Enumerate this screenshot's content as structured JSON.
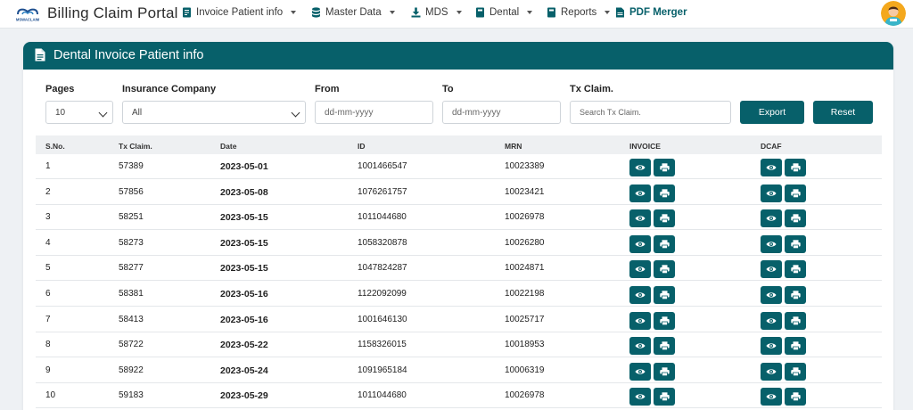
{
  "navbar": {
    "title": "Billing Claim Portal",
    "logo_text": "MSWACLAIM",
    "items": [
      {
        "label": "Invoice Patient info",
        "icon": "invoice-icon",
        "has_caret": true
      },
      {
        "label": "Master Data",
        "icon": "database-icon",
        "has_caret": true
      },
      {
        "label": "MDS",
        "icon": "download-icon",
        "has_caret": true
      },
      {
        "label": "Dental",
        "icon": "book-icon",
        "has_caret": true
      },
      {
        "label": "Reports",
        "icon": "book-icon",
        "has_caret": true
      },
      {
        "label": "PDF Merger",
        "icon": "pdf-file-icon",
        "has_caret": false
      }
    ]
  },
  "card": {
    "title": "Dental Invoice Patient info"
  },
  "filters": {
    "pages_label": "Pages",
    "pages_value": "10",
    "insurance_label": "Insurance Company",
    "insurance_value": "All",
    "from_label": "From",
    "from_placeholder": "dd-mm-yyyy",
    "to_label": "To",
    "to_placeholder": "dd-mm-yyyy",
    "txclaim_label": "Tx Claim.",
    "txclaim_placeholder": "Search Tx Claim.",
    "export_label": "Export",
    "reset_label": "Reset"
  },
  "table": {
    "headers": [
      "S.No.",
      "Tx Claim.",
      "Date",
      "ID",
      "MRN",
      "INVOICE",
      "DCAF"
    ],
    "rows": [
      [
        "1",
        "57389",
        "2023-05-01",
        "1001466547",
        "10023389"
      ],
      [
        "2",
        "57856",
        "2023-05-08",
        "1076261757",
        "10023421"
      ],
      [
        "3",
        "58251",
        "2023-05-15",
        "1011044680",
        "10026978"
      ],
      [
        "4",
        "58273",
        "2023-05-15",
        "1058320878",
        "10026280"
      ],
      [
        "5",
        "58277",
        "2023-05-15",
        "1047824287",
        "10024871"
      ],
      [
        "6",
        "58381",
        "2023-05-16",
        "1122092099",
        "10022198"
      ],
      [
        "7",
        "58413",
        "2023-05-16",
        "1001646130",
        "10025717"
      ],
      [
        "8",
        "58722",
        "2023-05-22",
        "1158326015",
        "10018953"
      ],
      [
        "9",
        "58922",
        "2023-05-24",
        "1091965184",
        "10006319"
      ],
      [
        "10",
        "59183",
        "2023-05-29",
        "1011044680",
        "10026978"
      ]
    ]
  },
  "colors": {
    "primary": "#07606a",
    "page_bg": "#eef1f4",
    "table_header_bg": "#eef0f2"
  }
}
